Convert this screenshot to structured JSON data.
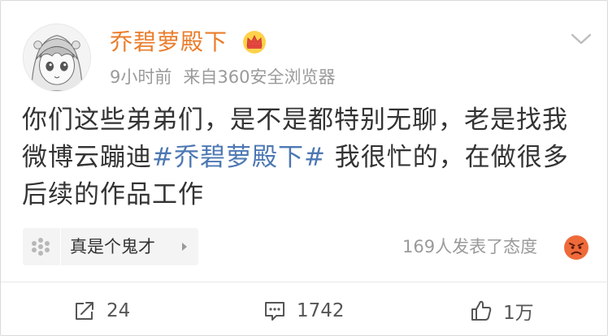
{
  "post": {
    "username": "乔碧萝殿下",
    "time": "9小时前",
    "source": "来自360安全浏览器",
    "content_before": "你们这些弟弟们，是不是都特别无聊，老是找我微博云蹦迪",
    "topic": "#乔碧萝殿下#",
    "content_after": " 我很忙的，在做很多后续的作品工作"
  },
  "reaction_chip": {
    "label": "真是个鬼才"
  },
  "reactions": {
    "summary": "169人发表了态度"
  },
  "actions": {
    "share_count": "24",
    "comment_count": "1742",
    "like_count": "1万"
  },
  "colors": {
    "username": "#ea7d2c",
    "topic": "#4d78b3",
    "meta": "#9a9a9a",
    "text": "#333333"
  },
  "icons": {
    "crown": "vip-crown-icon",
    "chevron": "chevron-down-icon",
    "chip": "flower-icon",
    "emoji": "angry-face-icon",
    "share": "share-icon",
    "comment": "comment-icon",
    "like": "thumbs-up-icon"
  }
}
